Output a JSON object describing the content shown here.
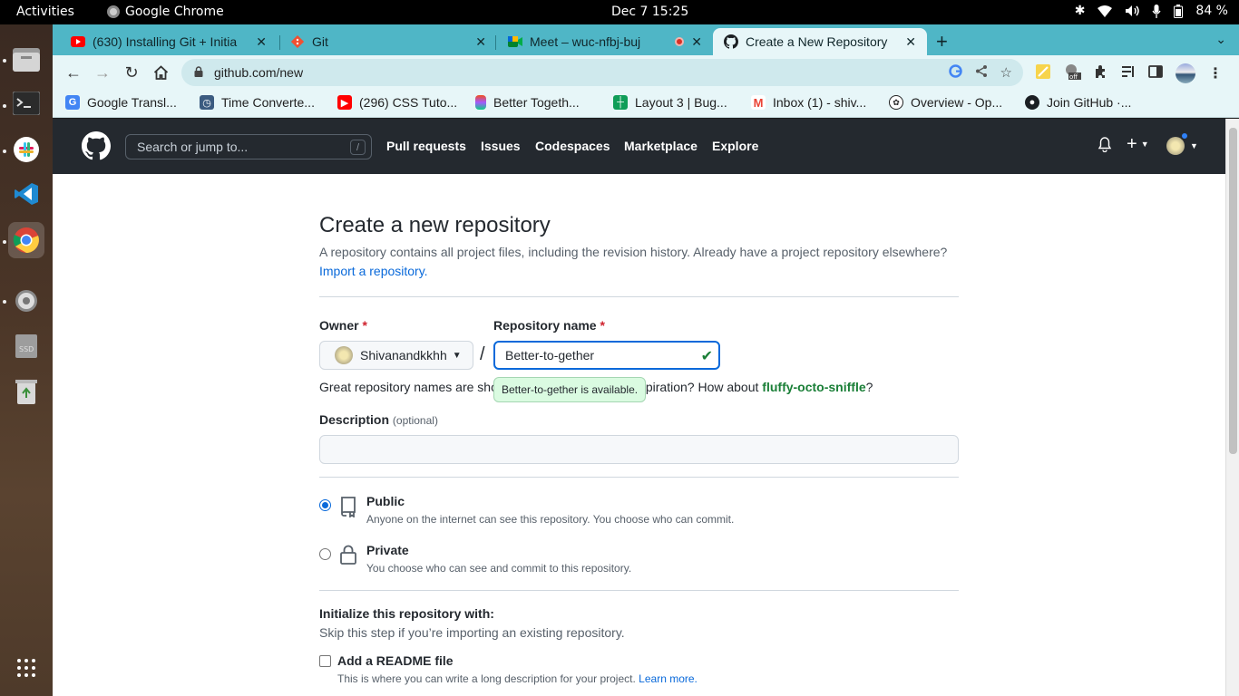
{
  "system": {
    "activities": "Activities",
    "app_name": "Google Chrome",
    "clock": "Dec 7  15:25",
    "battery": "84 %"
  },
  "tabs": [
    {
      "title": "(630) Installing Git + Initia",
      "favicon": "youtube-icon"
    },
    {
      "title": "Git",
      "favicon": "git-icon"
    },
    {
      "title": "Meet – wuc-nfbj-buj",
      "favicon": "meet-icon"
    },
    {
      "title": "Create a New Repository",
      "favicon": "github-icon",
      "active": true
    }
  ],
  "omnibox": {
    "url": "github.com/new"
  },
  "bookmarks": [
    {
      "label": "Google Transl...",
      "icon": "google-translate-icon"
    },
    {
      "label": "Time Converte...",
      "icon": "clock-icon"
    },
    {
      "label": "(296) CSS Tuto...",
      "icon": "youtube-icon"
    },
    {
      "label": "Better Togeth...",
      "icon": "figma-icon"
    },
    {
      "label": "Layout 3 | Bug...",
      "icon": "sheets-icon"
    },
    {
      "label": "Inbox (1) - shiv...",
      "icon": "gmail-icon"
    },
    {
      "label": "Overview - Op...",
      "icon": "openai-icon"
    },
    {
      "label": "Join GitHub ·...",
      "icon": "github-icon"
    }
  ],
  "github": {
    "search_placeholder": "Search or jump to...",
    "search_key": "/",
    "nav": [
      "Pull requests",
      "Issues",
      "Codespaces",
      "Marketplace",
      "Explore"
    ]
  },
  "form": {
    "title": "Create a new repository",
    "lead": "A repository contains all project files, including the revision history. Already have a project repository elsewhere?",
    "import_link": "Import a repository.",
    "owner_label": "Owner",
    "owner_value": "Shivanandkkhh",
    "repo_label": "Repository name",
    "repo_value": "Better-to-gether",
    "required_mark": "*",
    "separator": "/",
    "hint_prefix": "Great repository names are sho",
    "hint_middle": "spiration? How about ",
    "hint_suggestion": "fluffy-octo-sniffle",
    "hint_suffix": "?",
    "tooltip": "Better-to-gether is available.",
    "desc_label": "Description",
    "desc_optional": "(optional)",
    "public_title": "Public",
    "public_desc": "Anyone on the internet can see this repository. You choose who can commit.",
    "private_title": "Private",
    "private_desc": "You choose who can see and commit to this repository.",
    "init_title": "Initialize this repository with:",
    "init_sub": "Skip this step if you’re importing an existing repository.",
    "readme_label": "Add a README file",
    "readme_desc": "This is where you can write a long description for your project.",
    "learn_more": "Learn more."
  },
  "colors": {
    "tabstrip": "#4fb6c6",
    "toolbar": "#e7f6f8",
    "gh_header": "#24292f",
    "link": "#0969da",
    "success": "#1a7f37"
  }
}
